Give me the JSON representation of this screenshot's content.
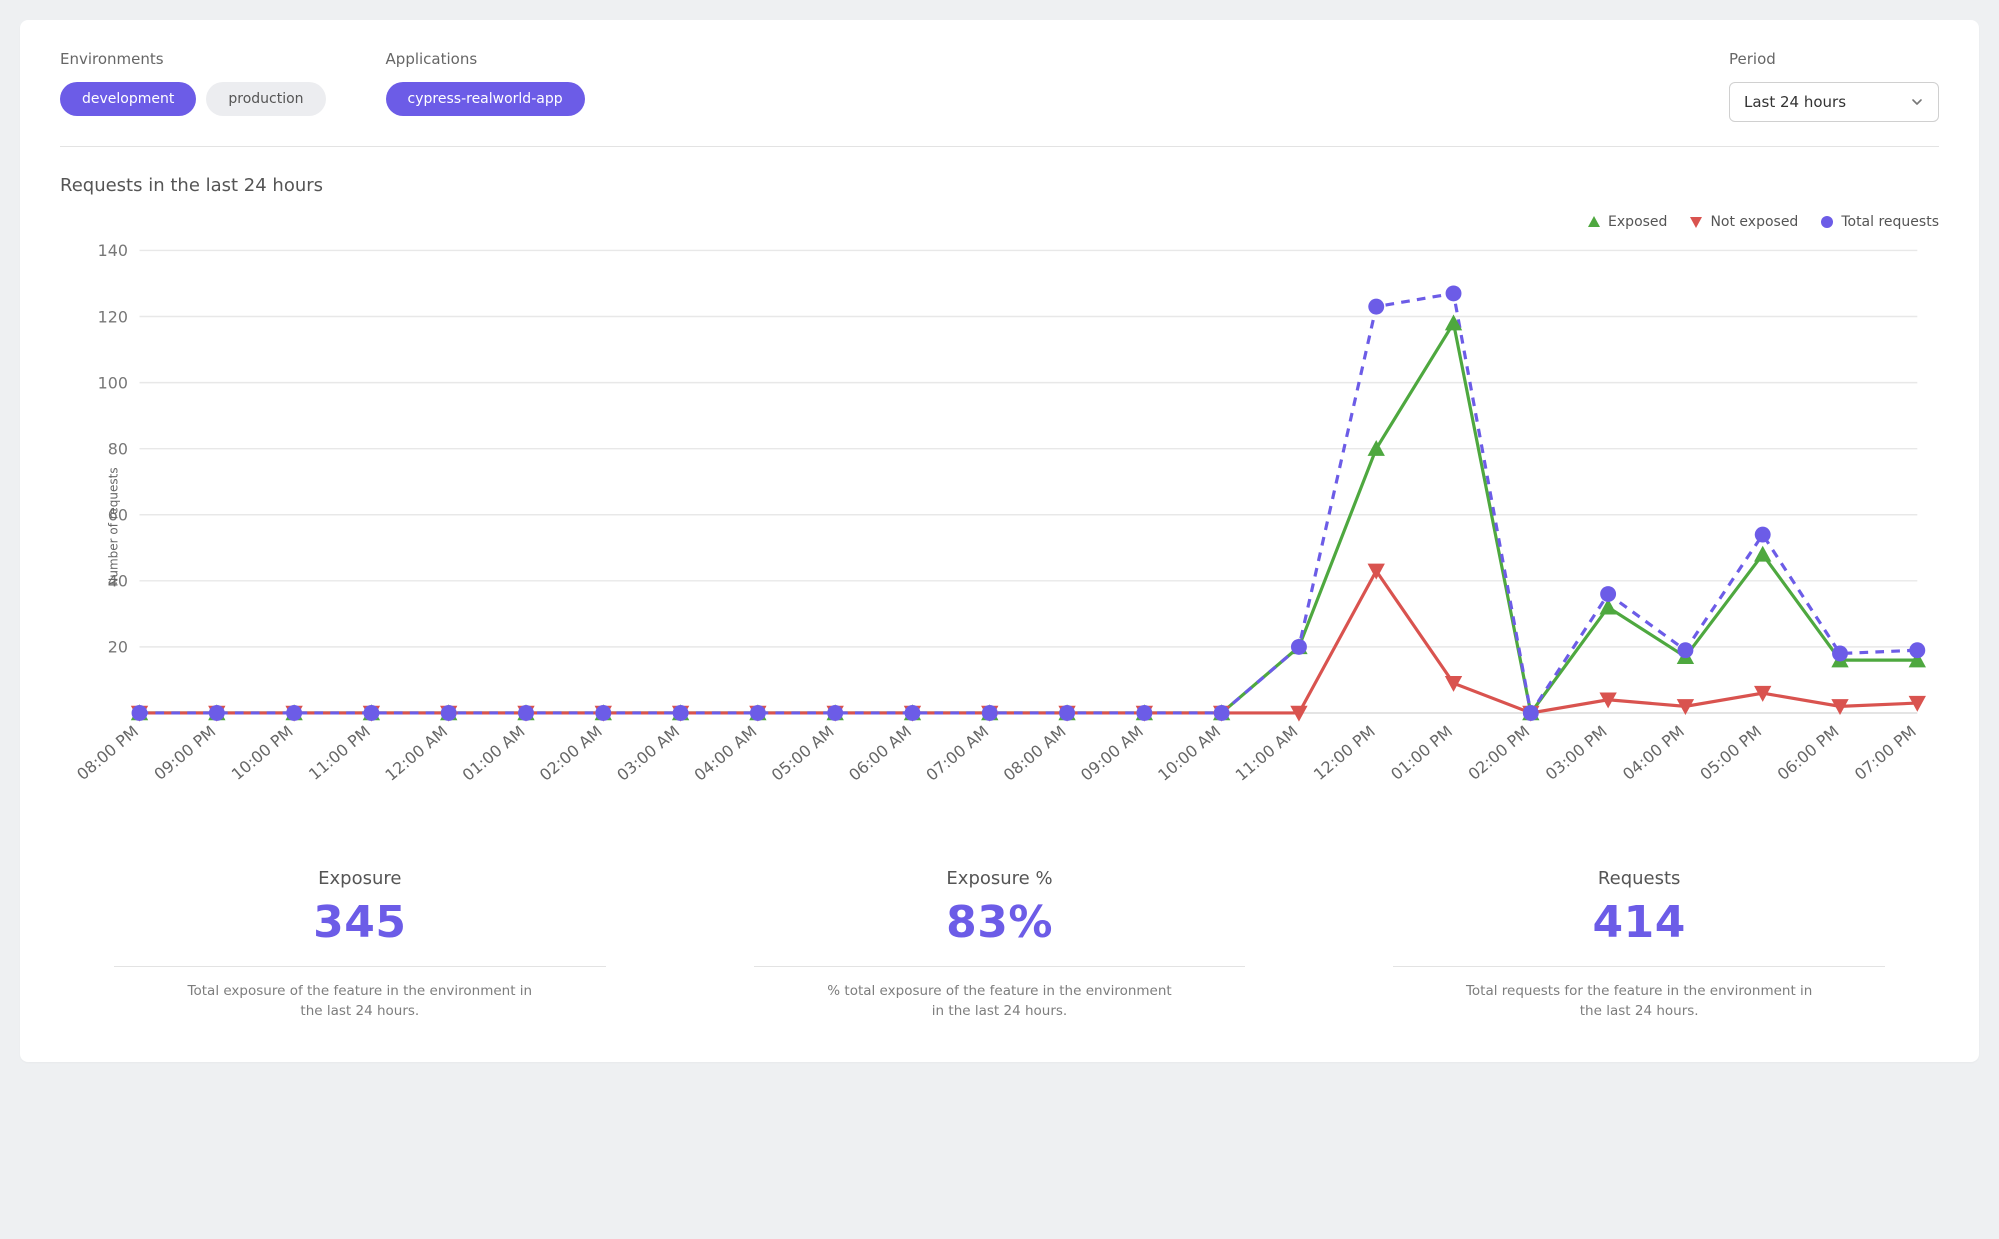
{
  "filters": {
    "environments_label": "Environments",
    "env_chips": [
      "development",
      "production"
    ],
    "env_selected_index": 0,
    "applications_label": "Applications",
    "app_chips": [
      "cypress-realworld-app"
    ],
    "app_selected_index": 0,
    "period_label": "Period",
    "period_value": "Last 24 hours"
  },
  "chart_title": "Requests in the last 24 hours",
  "legend": {
    "exposed": "Exposed",
    "not_exposed": "Not exposed",
    "total": "Total requests"
  },
  "y_label": "Number of requests",
  "chart_data": {
    "type": "line",
    "xlabel": "",
    "ylabel": "Number of requests",
    "ylim": [
      0,
      140
    ],
    "yticks": [
      20,
      40,
      60,
      80,
      100,
      120,
      140
    ],
    "categories": [
      "08:00 PM",
      "09:00 PM",
      "10:00 PM",
      "11:00 PM",
      "12:00 AM",
      "01:00 AM",
      "02:00 AM",
      "03:00 AM",
      "04:00 AM",
      "05:00 AM",
      "06:00 AM",
      "07:00 AM",
      "08:00 AM",
      "09:00 AM",
      "10:00 AM",
      "11:00 AM",
      "12:00 PM",
      "01:00 PM",
      "02:00 PM",
      "03:00 PM",
      "04:00 PM",
      "05:00 PM",
      "06:00 PM",
      "07:00 PM"
    ],
    "series": [
      {
        "name": "Exposed",
        "color": "#4EA83F",
        "marker": "triangle-up",
        "values": [
          0,
          0,
          0,
          0,
          0,
          0,
          0,
          0,
          0,
          0,
          0,
          0,
          0,
          0,
          0,
          20,
          80,
          118,
          0,
          32,
          17,
          48,
          16,
          16
        ]
      },
      {
        "name": "Not exposed",
        "color": "#D9534F",
        "marker": "triangle-down",
        "values": [
          0,
          0,
          0,
          0,
          0,
          0,
          0,
          0,
          0,
          0,
          0,
          0,
          0,
          0,
          0,
          0,
          43,
          9,
          0,
          4,
          2,
          6,
          2,
          3
        ]
      },
      {
        "name": "Total requests",
        "color": "#6C5CE7",
        "marker": "circle",
        "dashed": true,
        "values": [
          0,
          0,
          0,
          0,
          0,
          0,
          0,
          0,
          0,
          0,
          0,
          0,
          0,
          0,
          0,
          20,
          123,
          127,
          0,
          36,
          19,
          54,
          18,
          19
        ]
      }
    ]
  },
  "stats": [
    {
      "title": "Exposure",
      "value": "345",
      "desc": "Total exposure of the feature in the environment in the last 24 hours."
    },
    {
      "title": "Exposure %",
      "value": "83%",
      "desc": "% total exposure of the feature in the environment in the last 24 hours."
    },
    {
      "title": "Requests",
      "value": "414",
      "desc": "Total requests for the feature in the environment in the last 24 hours."
    }
  ]
}
